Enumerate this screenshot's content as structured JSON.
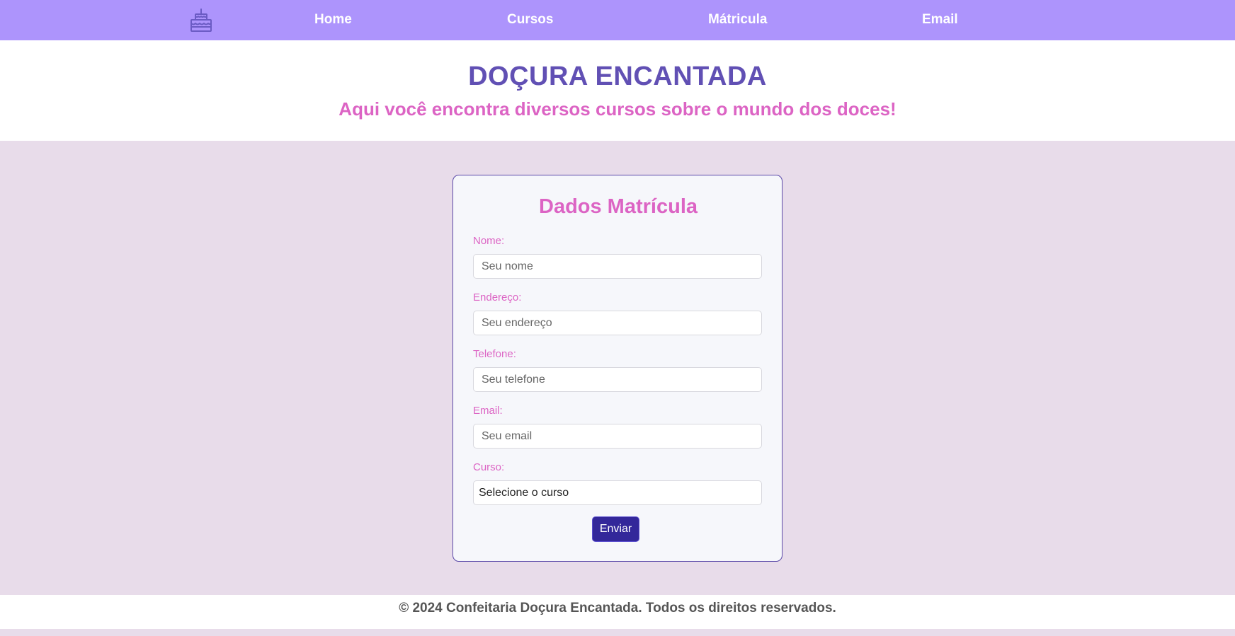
{
  "nav": {
    "logo_icon": "cake-icon",
    "items": [
      {
        "label": "Home"
      },
      {
        "label": "Cursos"
      },
      {
        "label": "Mátricula"
      },
      {
        "label": "Email"
      }
    ]
  },
  "header": {
    "title": "DOÇURA ENCANTADA",
    "subtitle": "Aqui você encontra diversos cursos sobre o mundo dos doces!"
  },
  "form": {
    "title": "Dados Matrícula",
    "fields": {
      "nome": {
        "label": "Nome:",
        "placeholder": "Seu nome",
        "value": ""
      },
      "endereco": {
        "label": "Endereço:",
        "placeholder": "Seu endereço",
        "value": ""
      },
      "telefone": {
        "label": "Telefone:",
        "placeholder": "Seu telefone",
        "value": ""
      },
      "email": {
        "label": "Email:",
        "placeholder": "Seu email",
        "value": ""
      },
      "curso": {
        "label": "Curso:",
        "selected": "Selecione o curso"
      }
    },
    "submit_label": "Enviar"
  },
  "footer": {
    "text": "© 2024 Confeitaria Doçura Encantada. Todos os direitos reservados."
  },
  "colors": {
    "nav_bg": "#ad94fc",
    "title": "#6150b4",
    "accent_pink": "#dc64c4",
    "button": "#33279a",
    "page_bg": "#e8dcea"
  }
}
